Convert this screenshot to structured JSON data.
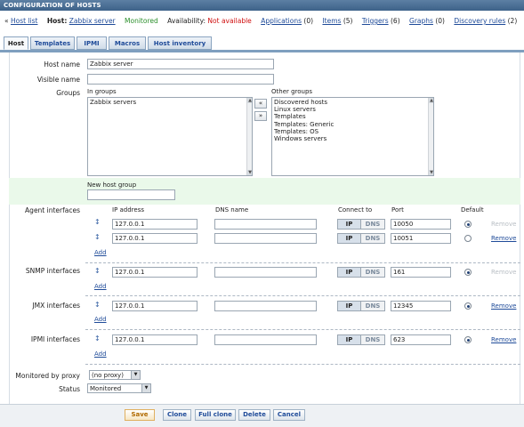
{
  "header": {
    "title": "CONFIGURATION OF HOSTS"
  },
  "nav": {
    "back_prefix": "«",
    "host_list": "Host list",
    "host_label": "Host:",
    "host_name": "Zabbix server",
    "status": "Monitored",
    "availability_label": "Availability:",
    "availability_value": "Not available",
    "links": [
      {
        "label": "Applications",
        "count": "(0)"
      },
      {
        "label": "Items",
        "count": "(5)"
      },
      {
        "label": "Triggers",
        "count": "(6)"
      },
      {
        "label": "Graphs",
        "count": "(0)"
      },
      {
        "label": "Discovery rules",
        "count": "(2)"
      }
    ]
  },
  "tabs": [
    "Host",
    "Templates",
    "IPMI",
    "Macros",
    "Host inventory"
  ],
  "form": {
    "host_name_label": "Host name",
    "host_name_value": "Zabbix server",
    "visible_name_label": "Visible name",
    "visible_name_value": "",
    "groups_label": "Groups",
    "in_groups_label": "In groups",
    "in_groups": [
      "Zabbix servers"
    ],
    "other_groups_label": "Other groups",
    "other_groups": [
      "Discovered hosts",
      "Linux servers",
      "Templates",
      "Templates: Generic",
      "Templates: OS",
      "Windows servers"
    ],
    "move_left": "«",
    "move_right": "»",
    "new_host_group_label": "New host group",
    "new_host_group_value": ""
  },
  "interfaces": {
    "col_ip": "IP address",
    "col_dns": "DNS name",
    "col_connect": "Connect to",
    "col_port": "Port",
    "col_default": "Default",
    "ip_btn": "IP",
    "dns_btn": "DNS",
    "remove": "Remove",
    "add": "Add",
    "drag": "↕",
    "agent_label": "Agent interfaces",
    "agent": [
      {
        "ip": "127.0.0.1",
        "dns": "",
        "port": "10050",
        "default": true
      },
      {
        "ip": "127.0.0.1",
        "dns": "",
        "port": "10051",
        "default": false
      }
    ],
    "snmp_label": "SNMP interfaces",
    "snmp": {
      "ip": "127.0.0.1",
      "dns": "",
      "port": "161",
      "default": true
    },
    "jmx_label": "JMX interfaces",
    "jmx": {
      "ip": "127.0.0.1",
      "dns": "",
      "port": "12345",
      "default": true
    },
    "ipmi_label": "IPMI interfaces",
    "ipmi": {
      "ip": "127.0.0.1",
      "dns": "",
      "port": "623",
      "default": true
    }
  },
  "proxy": {
    "label": "Monitored by proxy",
    "value": "(no proxy)"
  },
  "status": {
    "label": "Status",
    "value": "Monitored"
  },
  "buttons": {
    "save": "Save",
    "clone": "Clone",
    "full_clone": "Full clone",
    "delete": "Delete",
    "cancel": "Cancel"
  }
}
